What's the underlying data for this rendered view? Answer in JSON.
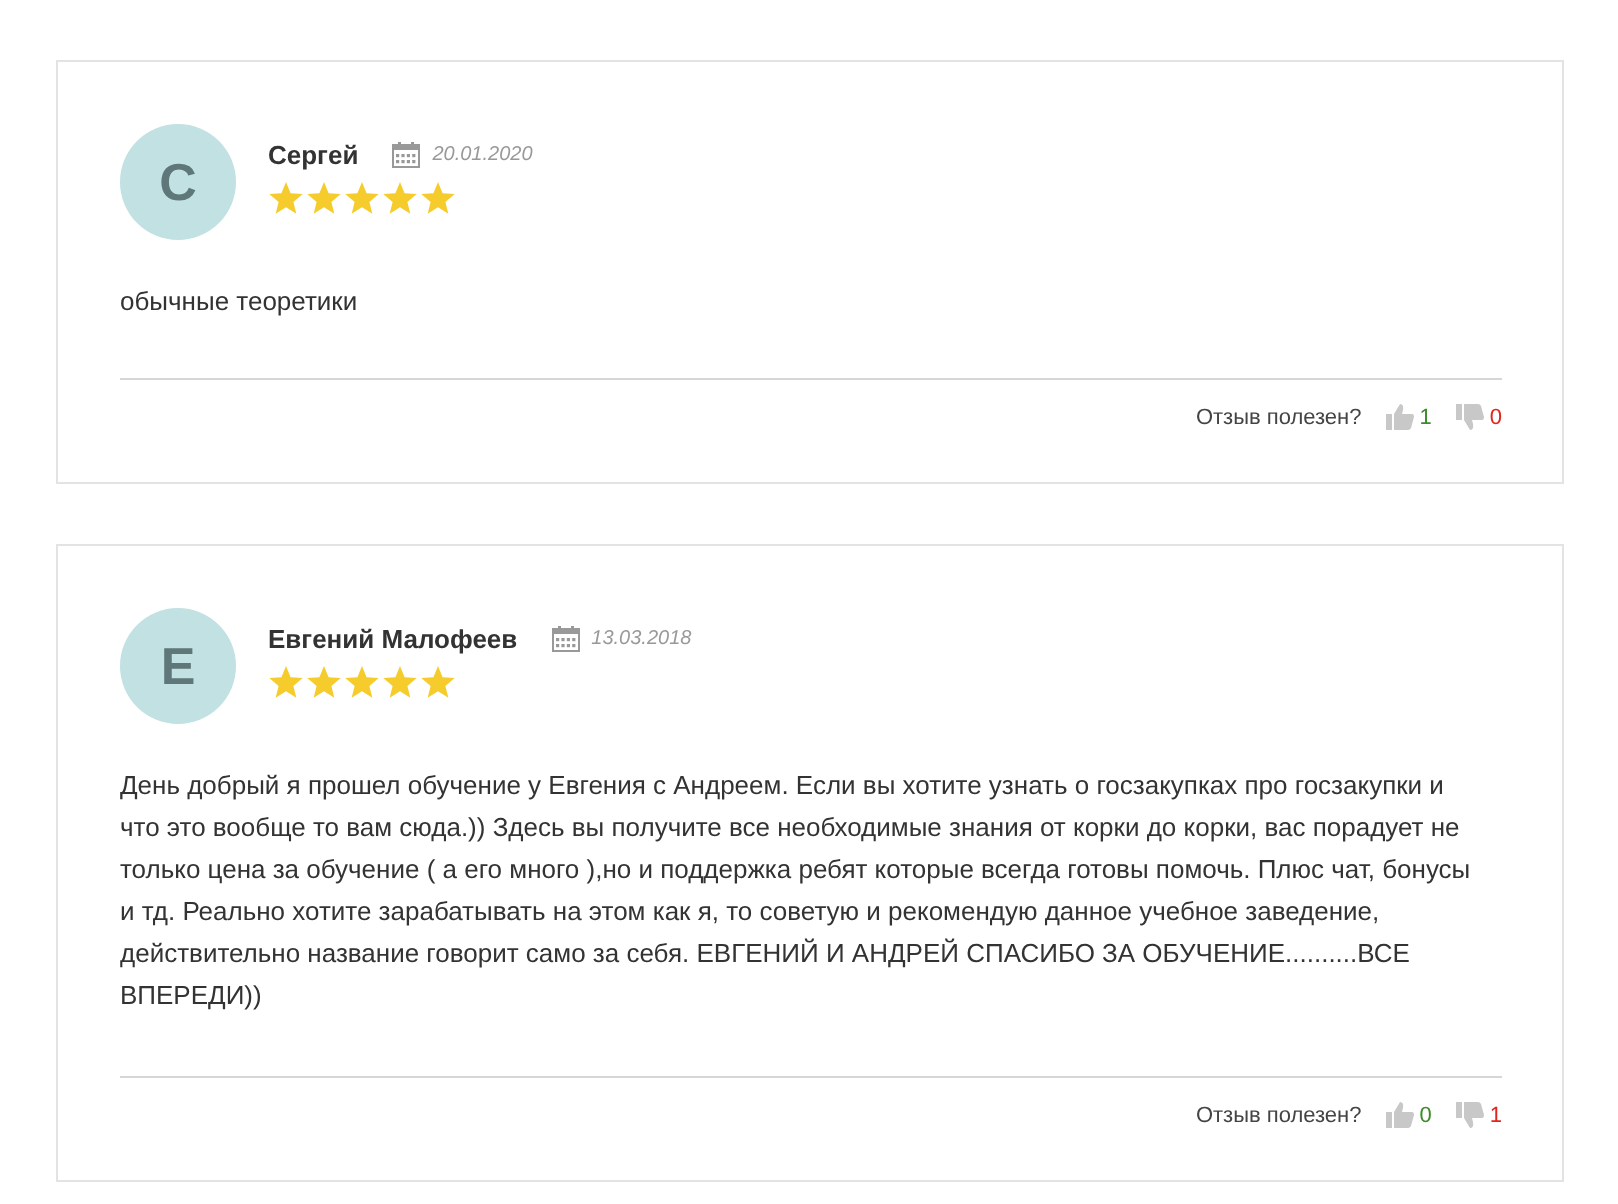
{
  "reviews": [
    {
      "initial": "С",
      "name": "Сергей",
      "date": "20.01.2020",
      "stars": 5,
      "text": "обычные теоретики",
      "helpful_label": "Отзыв полезен?",
      "likes": "1",
      "dislikes": "0"
    },
    {
      "initial": "Е",
      "name": "Евгений Малофеев",
      "date": "13.03.2018",
      "stars": 5,
      "text": "День добрый я прошел обучение у Евгения с Андреем. Если вы хотите узнать о госзакупках про госзакупки и что это вообще то вам сюда.)) Здесь вы получите все необходимые знания от корки до корки, вас порадует не только цена за обучение ( а его много ),но и поддержка ребят которые всегда готовы помочь. Плюс чат, бонусы и тд. Реально хотите зарабатывать на этом как я, то советую и рекомендую данное учебное заведение, действительно название говорит само за себя. ЕВГЕНИЙ И АНДРЕЙ СПАСИБО ЗА ОБУЧЕНИЕ..........ВСЕ ВПЕРЕДИ))",
      "helpful_label": "Отзыв полезен?",
      "likes": "0",
      "dislikes": "1"
    }
  ]
}
